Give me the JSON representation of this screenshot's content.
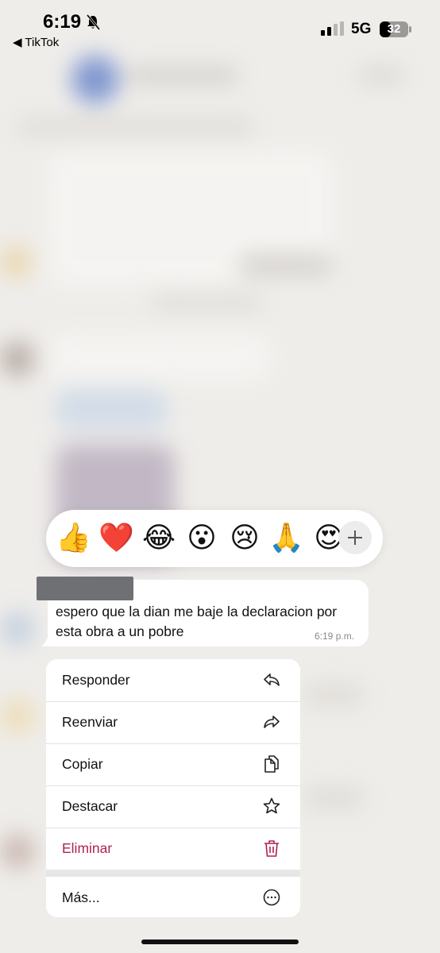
{
  "status_bar": {
    "time": "6:19",
    "back_app": "◀ TikTok",
    "network": "5G",
    "battery": "32"
  },
  "reactions": [
    "👍",
    "❤️",
    "😂",
    "😮",
    "😢",
    "🙏",
    "😍"
  ],
  "message": {
    "text": "espero que la dian me baje la declaracion por esta obra a un pobre",
    "time": "6:19 p.m."
  },
  "menu": {
    "reply": "Responder",
    "forward": "Reenviar",
    "copy": "Copiar",
    "star": "Destacar",
    "delete": "Eliminar",
    "more": "Más..."
  },
  "colors": {
    "delete": "#b0224b",
    "background": "#efedea"
  }
}
